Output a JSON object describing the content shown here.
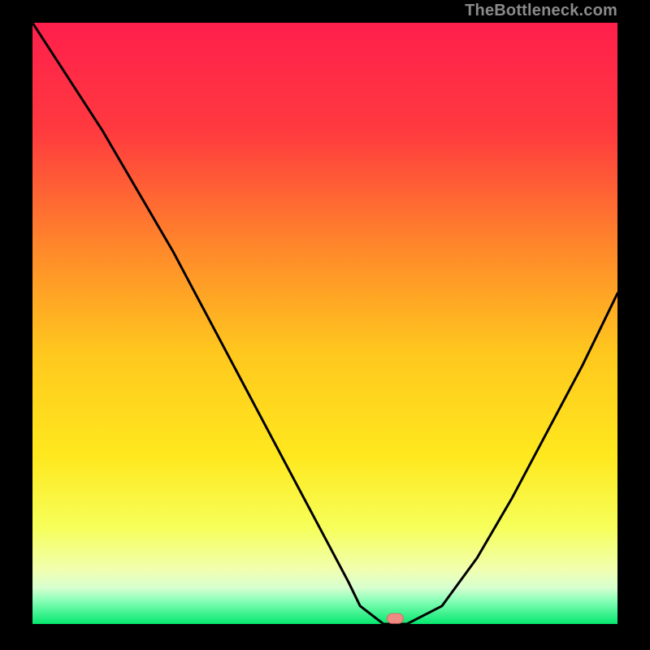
{
  "watermark": "TheBottleneck.com",
  "colors": {
    "background": "#000000",
    "gradient_top": "#ff1f4c",
    "gradient_mid_upper": "#ff6a2a",
    "gradient_mid": "#ffd400",
    "gradient_mid_lower": "#f7ff57",
    "gradient_pale": "#f3ffcf",
    "gradient_green": "#05e86f",
    "curve_stroke": "#000000",
    "marker_fill": "#f08b84",
    "marker_stroke": "#d86a63"
  },
  "chart_data": {
    "type": "line",
    "title": "",
    "xlabel": "",
    "ylabel": "",
    "xlim": [
      0,
      100
    ],
    "ylim": [
      0,
      100
    ],
    "series": [
      {
        "name": "bottleneck-curve",
        "x": [
          0,
          6,
          12,
          18,
          24,
          30,
          36,
          42,
          48,
          54,
          56,
          60,
          64,
          70,
          76,
          82,
          88,
          94,
          100
        ],
        "values": [
          100,
          91,
          82,
          72,
          62,
          51,
          40,
          29,
          18,
          7,
          3,
          0,
          0,
          3,
          11,
          21,
          32,
          43,
          55
        ]
      }
    ],
    "marker": {
      "x": 62,
      "y": 0.9
    }
  }
}
